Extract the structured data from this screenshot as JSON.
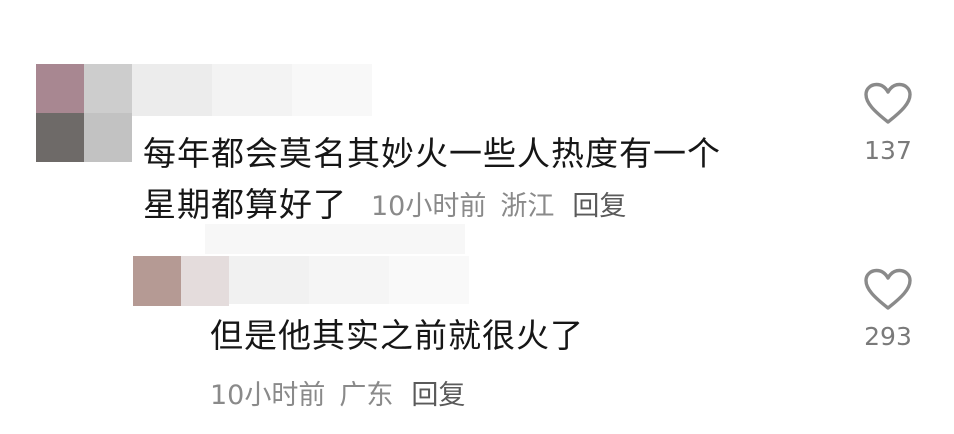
{
  "comments": [
    {
      "text_line1": "每年都会莫名其妙火一些人热度有一个",
      "text_line2": "星期都算好了",
      "time": "10小时前",
      "location": "浙江",
      "reply_label": "回复",
      "likes": "137"
    },
    {
      "text_line1": "但是他其实之前就很火了",
      "time": "10小时前",
      "location": "广东",
      "reply_label": "回复",
      "likes": "293"
    }
  ],
  "icons": {
    "like": "heart-outline-icon"
  },
  "colors": {
    "text": "#161616",
    "meta": "#8a8a8a",
    "reply": "#5a5a5a",
    "icon": "#8a8a8a"
  }
}
